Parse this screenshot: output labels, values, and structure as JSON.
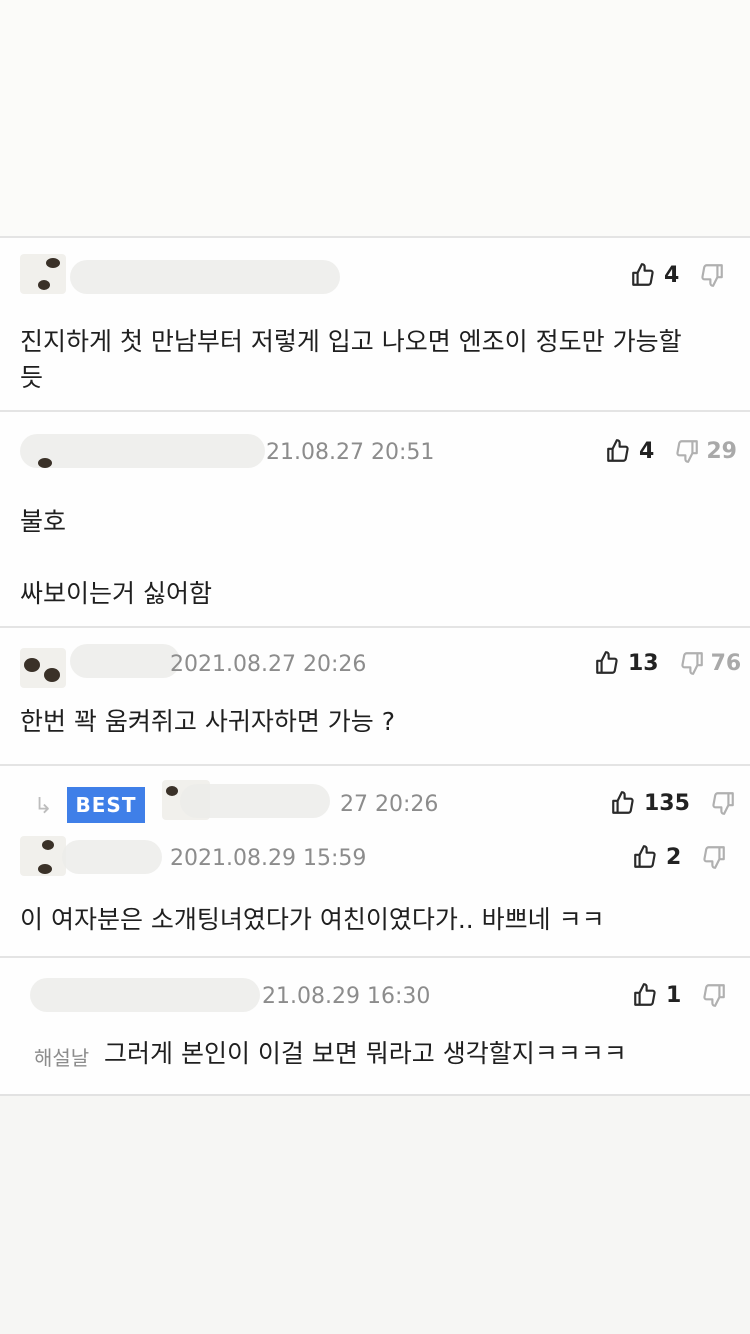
{
  "comments": [
    {
      "date": "",
      "up": "4",
      "down": "",
      "body": [
        "진지하게 첫 만남부터 저렇게 입고 나오면 엔조이 정도만 가능할",
        "듯"
      ]
    },
    {
      "date": "21.08.27 20:51",
      "up": "4",
      "down": "29",
      "body": [
        "불호",
        "",
        "싸보이는거 싫어함"
      ]
    },
    {
      "date": "2021.08.27 20:26",
      "up": "13",
      "down": "76",
      "body": [
        "한번 꽉 움켜쥐고 사귀자하면 가능 ?"
      ]
    },
    {
      "best_label": "BEST",
      "best_date": "27 20:26",
      "best_up": "135",
      "date": "2021.08.29 15:59",
      "up": "2",
      "down": "",
      "body": [
        "이 여자분은 소개팅녀였다가 여친이였다가.. 바쁘네 ㅋㅋ"
      ]
    },
    {
      "date": "21.08.29 16:30",
      "up": "1",
      "down": "",
      "reply_name": "해설날",
      "body": [
        "그러게 본인이 이걸 보면 뭐라고 생각할지ㅋㅋㅋㅋ"
      ]
    }
  ],
  "icons": {
    "upvote": "thumbs-up-icon",
    "downvote": "thumbs-down-icon",
    "reply": "reply-arrow-icon"
  },
  "colors": {
    "best_badge": "#3f7fe8",
    "date_text": "#8c8c8c",
    "downvote_count": "#a9a9a9"
  }
}
